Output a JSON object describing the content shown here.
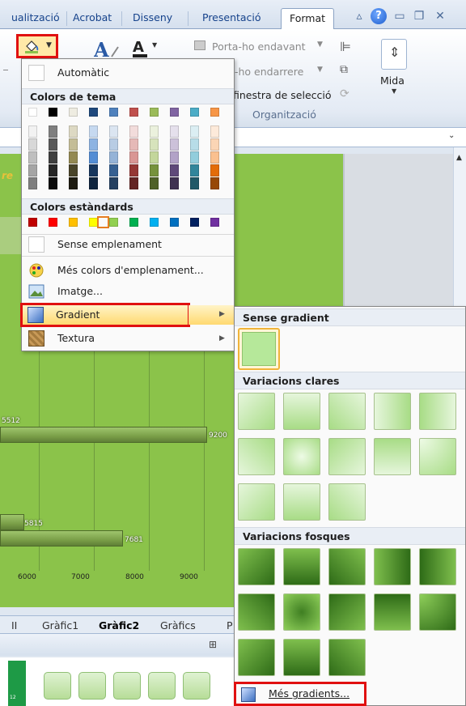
{
  "tabs": [
    "ualització",
    "Acrobat",
    "Disseny",
    "Presentació",
    "Format"
  ],
  "ribbon": {
    "arrange": {
      "bring_forward": "Porta-ho endavant",
      "send_backward": "-ho endarrere",
      "selection_pane": "finestra de selecció",
      "group_label": "Organització"
    },
    "size_label": "Mida"
  },
  "fill_menu": {
    "automatic": "Automàtic",
    "theme_colors_header": "Colors de tema",
    "standard_colors_header": "Colors estàndards",
    "no_fill": "Sense emplenament",
    "more_colors": "Més colors d'emplenament...",
    "picture": "Imatge...",
    "gradient": "Gradient",
    "texture": "Textura",
    "theme_top": [
      "#ffffff",
      "#000000",
      "#eeece1",
      "#1f497d",
      "#4f81bd",
      "#c0504d",
      "#9bbb59",
      "#8064a2",
      "#4bacc6",
      "#f79646"
    ],
    "theme_shades": [
      [
        "#f2f2f2",
        "#d8d8d8",
        "#bfbfbf",
        "#a5a5a5",
        "#7f7f7f"
      ],
      [
        "#7f7f7f",
        "#595959",
        "#3f3f3f",
        "#262626",
        "#0c0c0c"
      ],
      [
        "#ddd9c3",
        "#c4bd97",
        "#938953",
        "#494429",
        "#1d1b10"
      ],
      [
        "#c6d9f0",
        "#8db3e2",
        "#548dd4",
        "#17365d",
        "#0f243e"
      ],
      [
        "#dbe5f1",
        "#b8cce4",
        "#95b3d7",
        "#366092",
        "#244061"
      ],
      [
        "#f2dcdb",
        "#e5b9b7",
        "#d99694",
        "#953734",
        "#632423"
      ],
      [
        "#ebf1dd",
        "#d7e3bc",
        "#c3d69b",
        "#76923c",
        "#4f6128"
      ],
      [
        "#e5e0ec",
        "#ccc1d9",
        "#b2a2c7",
        "#5f497a",
        "#3f3151"
      ],
      [
        "#dbeef3",
        "#b7dde8",
        "#92cddc",
        "#31859b",
        "#205867"
      ],
      [
        "#fdeada",
        "#fbd5b5",
        "#fac08f",
        "#e36c09",
        "#974806"
      ]
    ],
    "standard": [
      "#c00000",
      "#ff0000",
      "#ffc000",
      "#ffff00",
      "#92d050",
      "#00b050",
      "#00b0f0",
      "#0070c0",
      "#002060",
      "#7030a0"
    ]
  },
  "gradient_menu": {
    "no_gradient": "Sense gradient",
    "light_variations": "Variacions clares",
    "dark_variations": "Variacions fosques",
    "more_gradients": "Més gradients..."
  },
  "chart": {
    "bar_labels": [
      "5512",
      "9200",
      "5815",
      "7681"
    ],
    "x_ticks": [
      "6000",
      "7000",
      "8000",
      "9000"
    ]
  },
  "sheet_tabs": [
    "II",
    "Gràfic1",
    "Gràfic2",
    "Gràfics",
    "P"
  ]
}
